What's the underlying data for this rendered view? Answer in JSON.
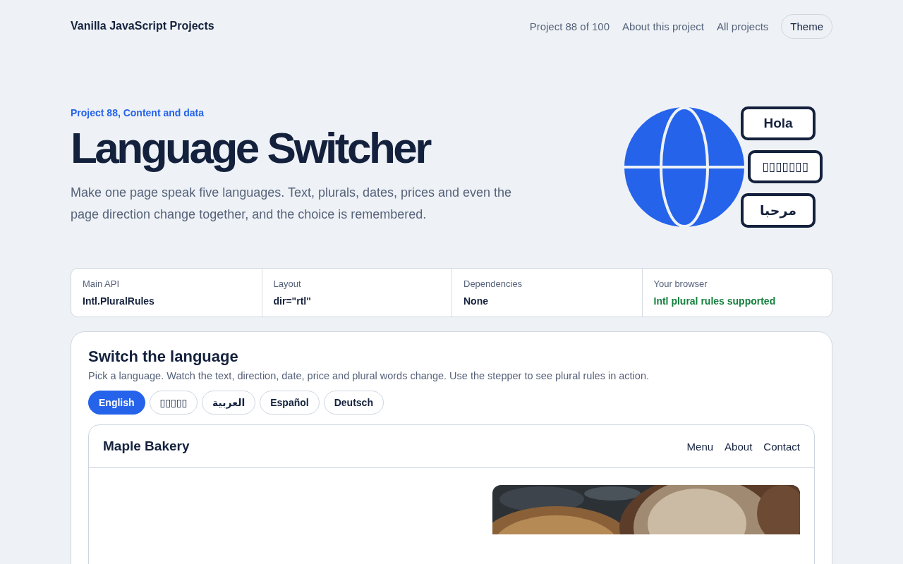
{
  "header": {
    "brand": "Vanilla JavaScript Projects",
    "nav": [
      {
        "label": "Project 88 of 100"
      },
      {
        "label": "About this project"
      },
      {
        "label": "All projects"
      }
    ],
    "theme_button": "Theme"
  },
  "hero": {
    "eyebrow": "Project 88, Content and data",
    "title": "Language Switcher",
    "description": "Make one page speak five languages. Text, plurals, dates, prices and even the page direction change together, and the choice is remembered.",
    "bubbles": [
      "Hola",
      "▯▯▯▯▯▯▯",
      "مرحبا"
    ]
  },
  "facts": [
    {
      "label": "Main API",
      "value": "Intl.PluralRules",
      "kind": "plain"
    },
    {
      "label": "Layout",
      "value": "dir=\"rtl\"",
      "kind": "plain"
    },
    {
      "label": "Dependencies",
      "value": "None",
      "kind": "plain"
    },
    {
      "label": "Your browser",
      "value": "Intl plural rules supported",
      "kind": "success"
    }
  ],
  "demo": {
    "title": "Switch the language",
    "description": "Pick a language. Watch the text, direction, date, price and plural words change. Use the stepper to see plural rules in action.",
    "languages": [
      {
        "label": "English",
        "selected": true
      },
      {
        "label": "▯▯▯▯▯",
        "selected": false
      },
      {
        "label": "العربية",
        "selected": false
      },
      {
        "label": "Español",
        "selected": false
      },
      {
        "label": "Deutsch",
        "selected": false
      }
    ],
    "preview": {
      "brand": "Maple Bakery",
      "nav": [
        "Menu",
        "About",
        "Contact"
      ],
      "image": {
        "kind": "picture"
      }
    }
  }
}
